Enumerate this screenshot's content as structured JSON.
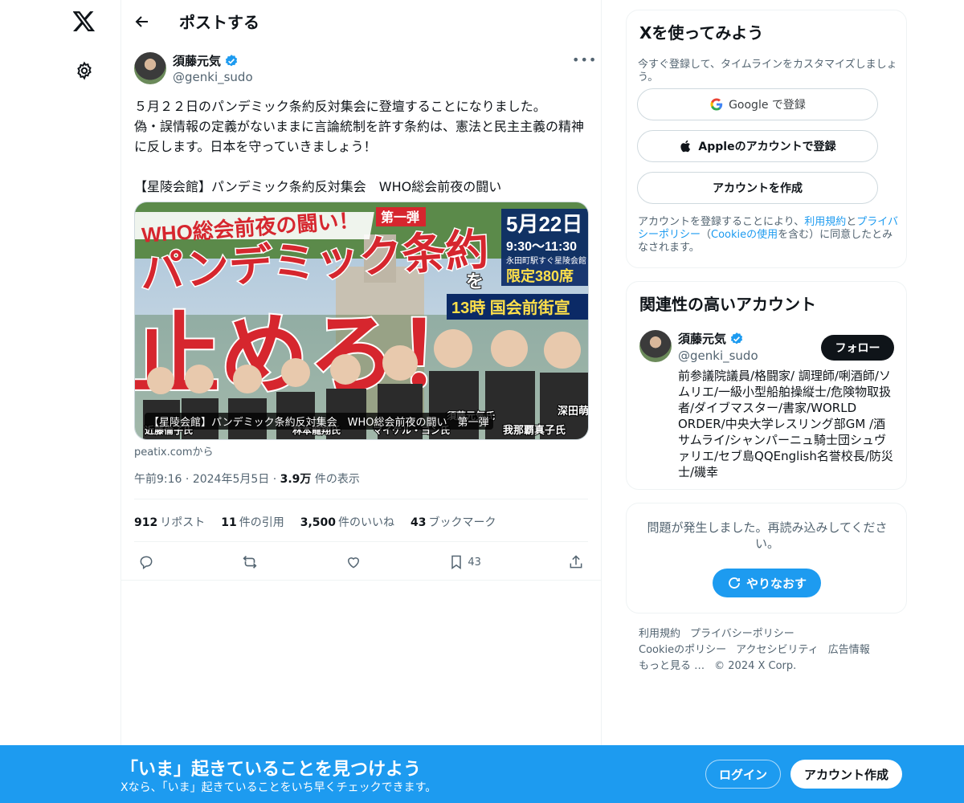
{
  "colors": {
    "accent": "#1d9bf0",
    "text": "#0f1419",
    "secondary": "#536471",
    "border": "#eff3f4"
  },
  "nav": {
    "logo_icon": "x-logo-icon",
    "settings_icon": "gear-icon"
  },
  "header": {
    "title": "ポストする"
  },
  "post": {
    "author_name": "須藤元気",
    "author_handle": "@genki_sudo",
    "text": "５月２２日のパンデミック条約反対集会に登壇することになりました。\n偽・誤情報の定義がないままに言論統制を許す条約は、憲法と民主主義の精神に反します。日本を守っていきましょう！\n\n【星陵会館】パンデミック条約反対集会　WHO総会前夜の闘い",
    "card": {
      "caption": "【星陵会館】パンデミック条約反対集会　WHO総会前夜の闘い　第一弾",
      "source": "peatix.comから",
      "image_text": {
        "top_banner": "WHO総会前夜の闘い！",
        "badge": "第一弾",
        "headline": "パンデミック条約",
        "particle": "を",
        "big": "止めろ！",
        "date": "5月22日",
        "time": "9:30〜11:30",
        "venue": "永田町駅すぐ星陵会館",
        "limit": "限定380席",
        "rally": "13時 国会前街宣",
        "names": [
          "近藤倫子氏",
          "林本龍翔氏",
          "マイケル・ヨン氏",
          "須藤元気氏",
          "我那覇真子氏",
          "深田萌"
        ]
      }
    },
    "time": "午前9:16",
    "date": "2024年5月5日",
    "views_count": "3.9万",
    "views_label": "件の表示",
    "stats": {
      "reposts_count": "912",
      "reposts_label": "リポスト",
      "quotes_count": "11",
      "quotes_label": "件の引用",
      "likes_count": "3,500",
      "likes_label": "件のいいね",
      "bookmarks_count": "43",
      "bookmarks_label": "ブックマーク"
    },
    "actions": {
      "bookmark_count": "43"
    }
  },
  "signup": {
    "title": "Xを使ってみよう",
    "subtitle": "今すぐ登録して、タイムラインをカスタマイズしましょう。",
    "google_label": "Google で登録",
    "apple_label": "Appleのアカウントで登録",
    "create_label": "アカウントを作成",
    "terms_pre": "アカウントを登録することにより、",
    "terms_link1": "利用規約",
    "terms_mid1": "と",
    "terms_link2": "プライバシーポリシー",
    "terms_mid2": "（",
    "terms_link3": "Cookieの使用",
    "terms_post": "を含む）に同意したとみなされます。"
  },
  "relevant": {
    "title": "関連性の高いアカウント",
    "name": "須藤元気",
    "handle": "@genki_sudo",
    "follow_label": "フォロー",
    "bio": "前参議院議員/格闘家/ 調理師/唎酒師/ソムリエ/一級小型船舶操縦士/危険物取扱者/ダイブマスター/書家/WORLD ORDER/中央大学レスリング部GM /酒サムライ/シャンパーニュ騎士団シュヴァリエ/セブ島QQEnglish名誉校長/防災士/磯幸"
  },
  "error": {
    "message": "問題が発生しました。再読み込みしてください。",
    "retry_label": "やりなおす"
  },
  "footer": {
    "links": [
      "利用規約",
      "プライバシーポリシー",
      "Cookieのポリシー",
      "アクセシビリティ",
      "広告情報",
      "もっと見る …"
    ],
    "copyright": "© 2024 X Corp."
  },
  "banner": {
    "title": "「いま」起きていることを見つけよう",
    "subtitle": "Xなら、「いま」起きていることをいち早くチェックできます。",
    "login_label": "ログイン",
    "signup_label": "アカウント作成"
  }
}
